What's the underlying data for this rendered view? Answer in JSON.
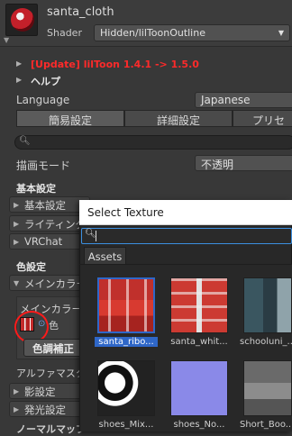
{
  "header": {
    "material_name": "santa_cloth",
    "shader_label": "Shader",
    "shader_value": "Hidden/lilToonOutline"
  },
  "inspector": {
    "update_text": "[Update] lilToon 1.4.1 -> 1.5.0",
    "help_text": "ヘルプ",
    "language_label": "Language",
    "language_value": "Japanese",
    "tabs": [
      "簡易設定",
      "詳細設定",
      "プリセ"
    ],
    "render_mode_label": "描画モード",
    "render_mode_value": "不透明",
    "basic_settings_title": "基本設定",
    "rows_basic": [
      "基本設定",
      "ライティング・",
      "VRChat"
    ],
    "color_settings_title": "色設定",
    "main_color_row": "メインカラー /",
    "main_color_label": "メインカラー",
    "color_label": "色",
    "tone_button": "色調補正",
    "alpha_mask_label": "アルファマスクを",
    "shadow_row": "影設定",
    "emission_row": "発光設定",
    "normal_label": "ノーマルマップ"
  },
  "dialog": {
    "title": "Select Texture",
    "search_placeholder": "",
    "tab": "Assets",
    "items": [
      {
        "label": "santa_ribo..."
      },
      {
        "label": "santa_whit..."
      },
      {
        "label": "schooluni_..."
      },
      {
        "label": "shoes_Mix..."
      },
      {
        "label": "shoes_No..."
      },
      {
        "label": "Short_Boo..."
      }
    ]
  },
  "colors": {
    "accent": "#2f67c8",
    "update_red": "#ff2a2a",
    "annotation_red": "#ff1a1a"
  }
}
